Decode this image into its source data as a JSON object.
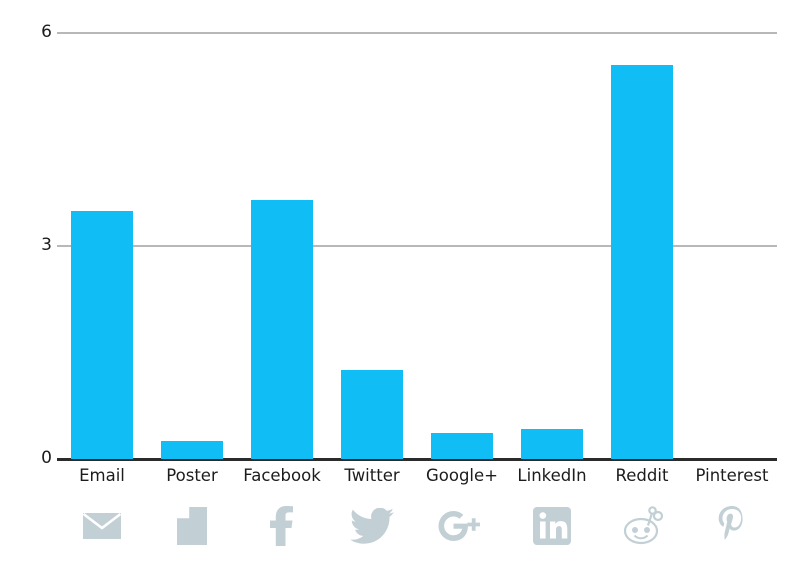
{
  "chart_data": {
    "type": "bar",
    "title": "",
    "subtitle": "",
    "xlabel": "",
    "ylabel": "",
    "ylim": [
      0,
      6
    ],
    "yticks": [
      "0",
      "3",
      "6"
    ],
    "ytick_values": [
      0,
      3,
      6
    ],
    "grid": "horizontal-only",
    "legend": "none",
    "bar_color": "#11bdf5",
    "icon_color": "#c2d0d6",
    "axis_color": "#2b2b2b",
    "gridline_color": "#b8b8b8",
    "categories": [
      "Email",
      "Poster",
      "Facebook",
      "Twitter",
      "Google+",
      "LinkedIn",
      "Reddit",
      "Pinterest"
    ],
    "values": [
      3.5,
      0.25,
      3.65,
      1.25,
      0.37,
      0.42,
      5.55,
      0
    ],
    "icons": [
      "envelope-icon",
      "document-icon",
      "facebook-icon",
      "twitter-icon",
      "googleplus-icon",
      "linkedin-icon",
      "reddit-icon",
      "pinterest-icon"
    ]
  },
  "axis": {
    "y": {
      "tick_top": "6",
      "tick_mid": "3",
      "tick_bottom": "0"
    }
  },
  "categories": [
    {
      "label": "Email",
      "value": 3.5,
      "icon": "envelope-icon"
    },
    {
      "label": "Poster",
      "value": 0.25,
      "icon": "document-icon"
    },
    {
      "label": "Facebook",
      "value": 3.65,
      "icon": "facebook-icon"
    },
    {
      "label": "Twitter",
      "value": 1.25,
      "icon": "twitter-icon"
    },
    {
      "label": "Google+",
      "value": 0.37,
      "icon": "googleplus-icon"
    },
    {
      "label": "LinkedIn",
      "value": 0.42,
      "icon": "linkedin-icon"
    },
    {
      "label": "Reddit",
      "value": 5.55,
      "icon": "reddit-icon"
    },
    {
      "label": "Pinterest",
      "value": 0,
      "icon": "pinterest-icon"
    }
  ]
}
